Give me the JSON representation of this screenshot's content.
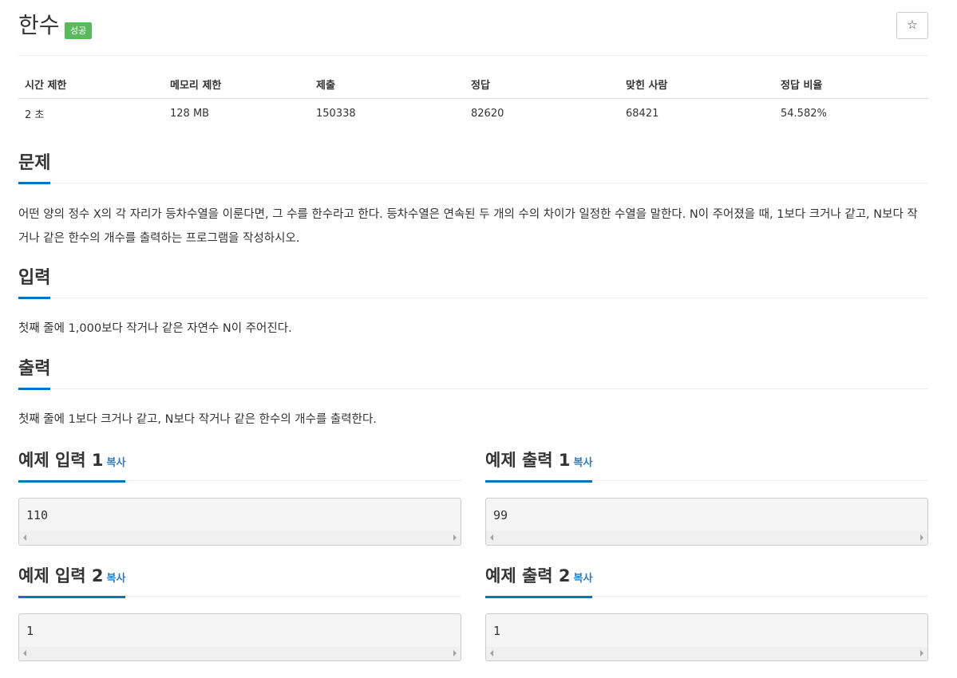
{
  "header": {
    "title": "한수",
    "badge": "성공",
    "star_icon": "☆"
  },
  "info": {
    "headers": [
      "시간 제한",
      "메모리 제한",
      "제출",
      "정답",
      "맞힌 사람",
      "정답 비율"
    ],
    "values": [
      "2 초",
      "128 MB",
      "150338",
      "82620",
      "68421",
      "54.582%"
    ]
  },
  "sections": {
    "problem": {
      "title": "문제",
      "text": "어떤 양의 정수 X의 각 자리가 등차수열을 이룬다면, 그 수를 한수라고 한다. 등차수열은 연속된 두 개의 수의 차이가 일정한 수열을 말한다. N이 주어졌을 때, 1보다 크거나 같고, N보다 작거나 같은 한수의 개수를 출력하는 프로그램을 작성하시오."
    },
    "input": {
      "title": "입력",
      "text": "첫째 줄에 1,000보다 작거나 같은 자연수 N이 주어진다."
    },
    "output": {
      "title": "출력",
      "text": "첫째 줄에 1보다 크거나 같고, N보다 작거나 같은 한수의 개수를 출력한다."
    }
  },
  "examples": [
    {
      "title": "예제 입력 1",
      "copy": "복사",
      "code": "110"
    },
    {
      "title": "예제 출력 1",
      "copy": "복사",
      "code": "99"
    },
    {
      "title": "예제 입력 2",
      "copy": "복사",
      "code": "1"
    },
    {
      "title": "예제 출력 2",
      "copy": "복사",
      "code": "1"
    }
  ]
}
